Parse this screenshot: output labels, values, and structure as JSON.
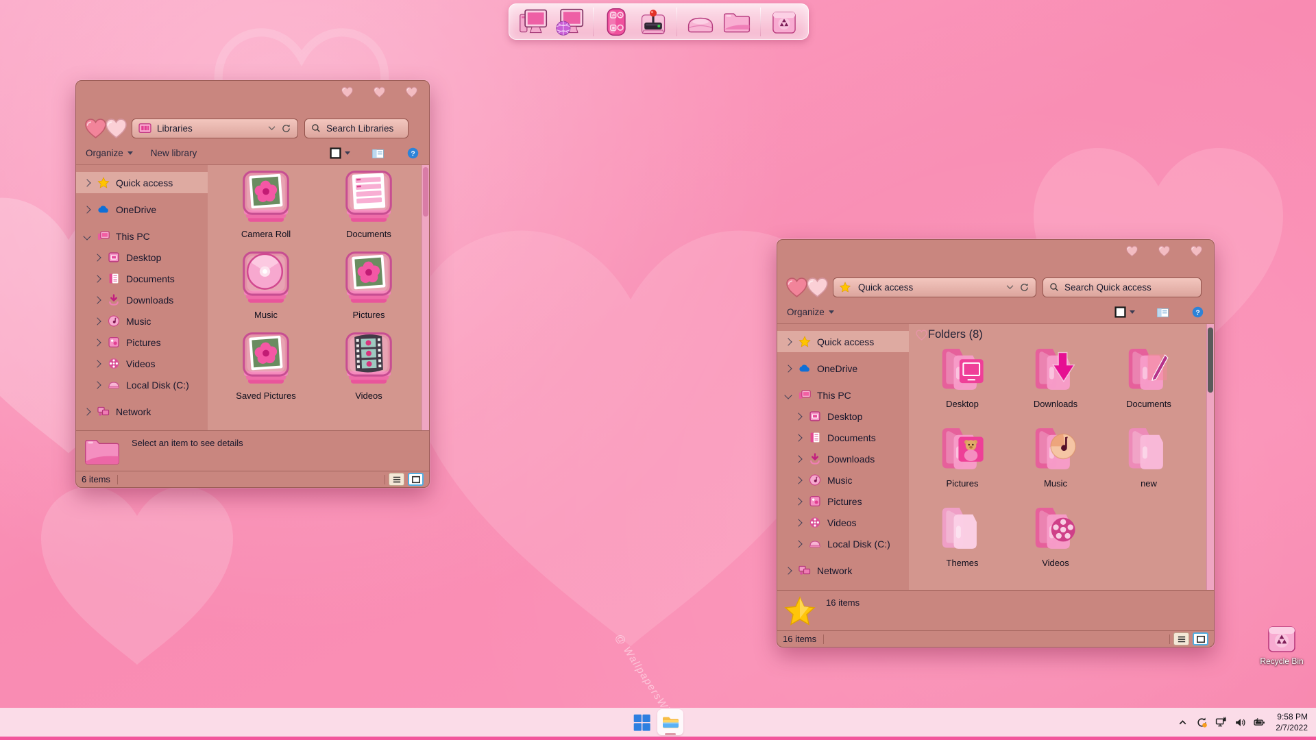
{
  "desktop": {
    "watermark": "@ WallpapersWide...",
    "recycle_bin": {
      "label": "Recycle Bin",
      "icon": "recycle-bin"
    }
  },
  "dock": {
    "items": [
      {
        "name": "computer",
        "icon": "dock-computer"
      },
      {
        "name": "internet",
        "icon": "dock-internet"
      },
      {
        "name": "widgets",
        "icon": "dock-widgets"
      },
      {
        "name": "games",
        "icon": "dock-games"
      },
      {
        "name": "drive",
        "icon": "dock-drive"
      },
      {
        "name": "folder",
        "icon": "dock-folder"
      },
      {
        "name": "recycle",
        "icon": "dock-recycle"
      }
    ],
    "divider_after": [
      1,
      3,
      5
    ]
  },
  "windows": [
    {
      "address": "Libraries",
      "address_icon": "libraries",
      "search_placeholder": "Search Libraries",
      "toolbar": {
        "organize": "Organize",
        "new_library": "New library"
      },
      "sidebar": [
        {
          "label": "Quick access",
          "icon": "star",
          "selected": true
        },
        {
          "label": "OneDrive",
          "icon": "cloud",
          "gap": true
        },
        {
          "label": "This PC",
          "icon": "pc",
          "expanded": true,
          "gap": true
        },
        {
          "label": "Desktop",
          "icon": "desktop",
          "child": true
        },
        {
          "label": "Documents",
          "icon": "documents",
          "child": true
        },
        {
          "label": "Downloads",
          "icon": "downloads",
          "child": true
        },
        {
          "label": "Music",
          "icon": "music",
          "child": true
        },
        {
          "label": "Pictures",
          "icon": "pictures",
          "child": true
        },
        {
          "label": "Videos",
          "icon": "videos",
          "child": true
        },
        {
          "label": "Local Disk (C:)",
          "icon": "disk",
          "child": true
        },
        {
          "label": "Network",
          "icon": "network",
          "gap": true
        }
      ],
      "items": [
        {
          "label": "Camera Roll",
          "icon": "lib-photo"
        },
        {
          "label": "Documents",
          "icon": "lib-doc"
        },
        {
          "label": "Music",
          "icon": "lib-music"
        },
        {
          "label": "Pictures",
          "icon": "lib-photo"
        },
        {
          "label": "Saved Pictures",
          "icon": "lib-photo"
        },
        {
          "label": "Videos",
          "icon": "lib-video"
        }
      ],
      "details": {
        "icon": "big-folder",
        "text": "Select an item to see details"
      },
      "status": "6 items"
    },
    {
      "address": "Quick access",
      "address_icon": "star",
      "search_placeholder": "Search Quick access",
      "toolbar": {
        "organize": "Organize"
      },
      "content_header": "Folders (8)",
      "sidebar": [
        {
          "label": "Quick access",
          "icon": "star",
          "selected": true
        },
        {
          "label": "OneDrive",
          "icon": "cloud",
          "gap": true
        },
        {
          "label": "This PC",
          "icon": "pc",
          "expanded": true,
          "gap": true
        },
        {
          "label": "Desktop",
          "icon": "desktop",
          "child": true
        },
        {
          "label": "Documents",
          "icon": "documents",
          "child": true
        },
        {
          "label": "Downloads",
          "icon": "downloads",
          "child": true
        },
        {
          "label": "Music",
          "icon": "music",
          "child": true
        },
        {
          "label": "Pictures",
          "icon": "pictures",
          "child": true
        },
        {
          "label": "Videos",
          "icon": "videos",
          "child": true
        },
        {
          "label": "Local Disk (C:)",
          "icon": "disk",
          "child": true
        },
        {
          "label": "Network",
          "icon": "network",
          "gap": true
        }
      ],
      "items": [
        {
          "label": "Desktop",
          "icon": "folder-desktop"
        },
        {
          "label": "Downloads",
          "icon": "folder-downloads"
        },
        {
          "label": "Documents",
          "icon": "folder-documents"
        },
        {
          "label": "Pictures",
          "icon": "folder-pictures"
        },
        {
          "label": "Music",
          "icon": "folder-music"
        },
        {
          "label": "new",
          "icon": "folder-plain"
        },
        {
          "label": "Themes",
          "icon": "folder-themes"
        },
        {
          "label": "Videos",
          "icon": "folder-videos"
        }
      ],
      "details": {
        "icon": "big-star",
        "text": "16 items"
      },
      "status": "16 items"
    }
  ],
  "taskbar": {
    "tray": {
      "icons": [
        {
          "name": "hidden-icons",
          "icon": "tray-chevron"
        },
        {
          "name": "sync",
          "icon": "tray-sync"
        },
        {
          "name": "network",
          "icon": "tray-net"
        },
        {
          "name": "volume",
          "icon": "tray-vol"
        },
        {
          "name": "battery",
          "icon": "tray-batt"
        }
      ],
      "time": "9:58 PM",
      "date": "2/7/2022"
    }
  },
  "colors": {
    "window_chrome": "#c9867f",
    "content_bg": "#d3968e",
    "selection": "#deaaa1",
    "taskbar": "#fbdce8",
    "taskbar_stripe": "#f2569c",
    "desktop_pink": "#f98bb2",
    "accent_pink": "#ef64a3"
  }
}
